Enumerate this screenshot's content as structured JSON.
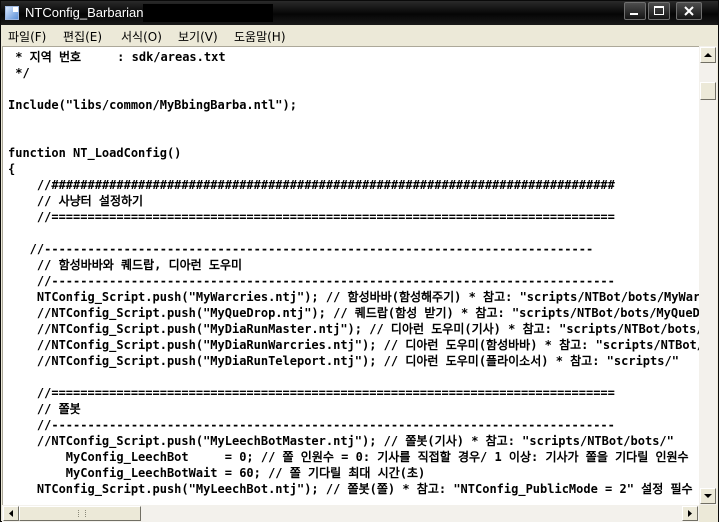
{
  "window": {
    "title": "NTConfig_Barbarian."
  },
  "menu": [
    {
      "label": "파일(F)"
    },
    {
      "label": "편집(E)"
    },
    {
      "label": "서식(O)"
    },
    {
      "label": "보기(V)"
    },
    {
      "label": "도움말(H)"
    }
  ],
  "editor": {
    "lines": [
      " * 지역 번호     : sdk/areas.txt",
      " */",
      "",
      "Include(\"libs/common/MyBbingBarba.ntl\");",
      "",
      "",
      "function NT_LoadConfig()",
      "{",
      "    //##############################################################################",
      "    // 사냥터 설정하기",
      "    //==============================================================================",
      "",
      "   //----------------------------------------------------------------------------",
      "    // 함성바바와 퀘드랍, 디아런 도우미",
      "    //------------------------------------------------------------------------------",
      "    NTConfig_Script.push(\"MyWarcries.ntj\"); // 함성바바(함성해주기) * 참고: \"scripts/NTBot/bots/MyWarcries.ntj\"",
      "    //NTConfig_Script.push(\"MyQueDrop.ntj\"); // 퀘드랍(함성 받기) * 참고: \"scripts/NTBot/bots/MyQueDrop.ntj\"",
      "    //NTConfig_Script.push(\"MyDiaRunMaster.ntj\"); // 디아런 도우미(기사) * 참고: \"scripts/NTBot/bots/\"",
      "    //NTConfig_Script.push(\"MyDiaRunWarcries.ntj\"); // 디아런 도우미(함성바바) * 참고: \"scripts/NTBot/\"",
      "    //NTConfig_Script.push(\"MyDiaRunTeleport.ntj\"); // 디아런 도우미(플라이소서) * 참고: \"scripts/\"",
      "",
      "    //==============================================================================",
      "    // 쫄봇",
      "    //------------------------------------------------------------------------------",
      "    //NTConfig_Script.push(\"MyLeechBotMaster.ntj\"); // 쫄봇(기사) * 참고: \"scripts/NTBot/bots/\"",
      "        MyConfig_LeechBot     = 0; // 쫄 인원수 = 0: 기사를 직접할 경우/ 1 이상: 기사가 쫄을 기다릴 인원수",
      "        MyConfig_LeechBotWait = 60; // 쫄 기다릴 최대 시간(초)",
      "    NTConfig_Script.push(\"MyLeechBot.ntj\"); // 쫄봇(쫄) * 참고: \"NTConfig_PublicMode = 2\" 설정 필수"
    ]
  }
}
